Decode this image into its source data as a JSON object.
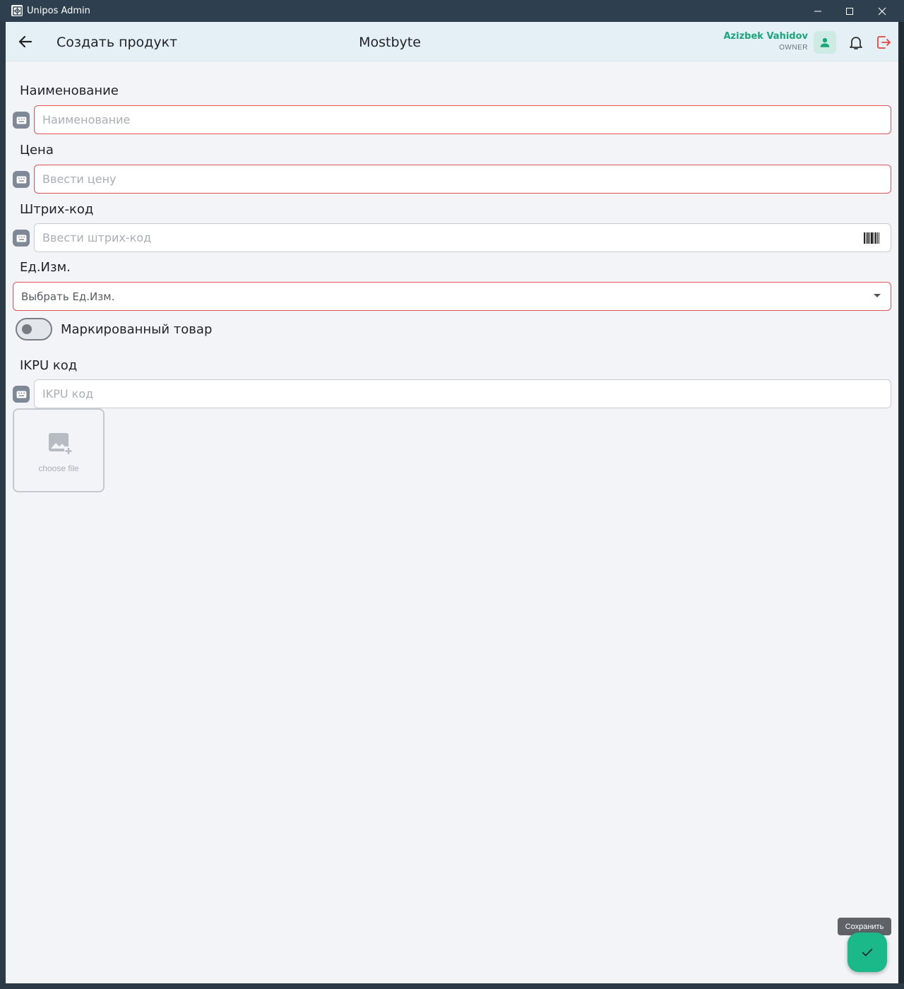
{
  "window": {
    "title": "Unipos Admin"
  },
  "appbar": {
    "page_title": "Создать продукт",
    "company": "Mostbyte",
    "user_name": "Azizbek Vahidov",
    "user_role": "OWNER"
  },
  "form": {
    "name": {
      "label": "Наименование",
      "placeholder": "Наименование",
      "value": ""
    },
    "price": {
      "label": "Цена",
      "placeholder": "Ввести цену",
      "value": ""
    },
    "barcode": {
      "label": "Штрих-код",
      "placeholder": "Ввести штрих-код",
      "value": ""
    },
    "unit": {
      "label": "Ед.Изм.",
      "placeholder": "Выбрать Ед.Изм."
    },
    "marked": {
      "label": "Маркированный товар",
      "checked": false
    },
    "ikpu": {
      "label": "IKPU код",
      "placeholder": "IKPU код",
      "value": ""
    },
    "upload": {
      "label": "choose file"
    }
  },
  "save": {
    "tooltip": "Сохранить"
  },
  "colors": {
    "accent": "#1bb88a",
    "error": "#e05358",
    "appbar_bg": "#e4f0f5",
    "page_bg": "#f2f4f8"
  }
}
